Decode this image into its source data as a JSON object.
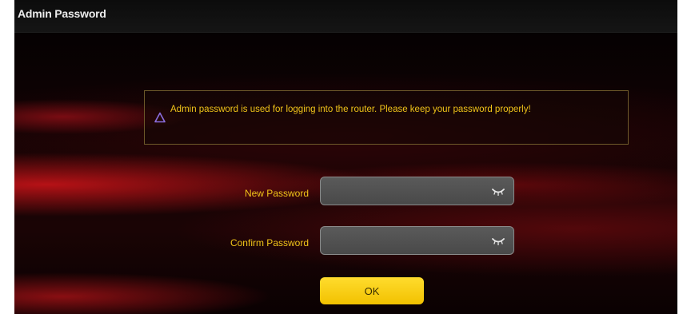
{
  "window": {
    "title": "Admin Password"
  },
  "notice": {
    "icon": "warning-triangle-icon",
    "text": "Admin password is used for logging into the router. Please keep your password properly!"
  },
  "form": {
    "new_password": {
      "label": "New Password",
      "value": "",
      "icon": "eye-closed-icon"
    },
    "confirm_password": {
      "label": "Confirm Password",
      "value": "",
      "icon": "eye-closed-icon"
    },
    "ok_label": "OK"
  },
  "colors": {
    "accent_text": "#f0c419",
    "button_bg": "#f8d20f",
    "background": "#000000",
    "accent_red": "#c8141e"
  }
}
